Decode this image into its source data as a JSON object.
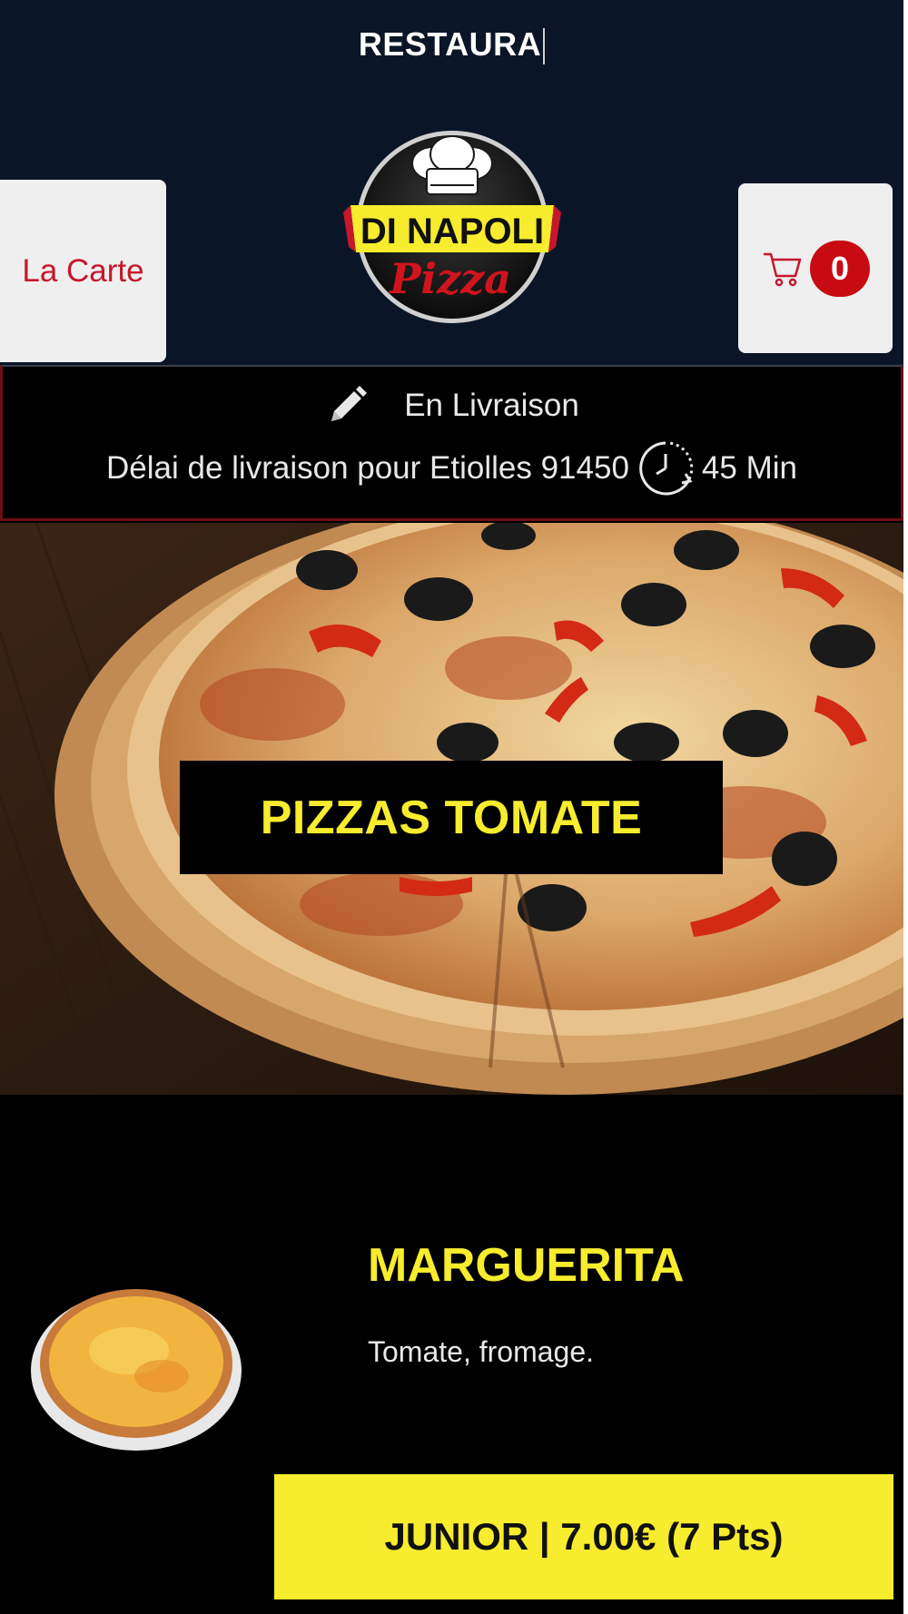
{
  "header": {
    "title": "RESTAURA",
    "menu_button_label": "La Carte",
    "cart_count": "0",
    "logo": {
      "top_text": "DI NAPOLI",
      "script_text": "Pizza"
    }
  },
  "delivery": {
    "mode": "En Livraison",
    "delay_text": "Délai de livraison pour Etiolles 91450",
    "delay_value": "45 Min"
  },
  "category": {
    "title": "PIZZAS TOMATE"
  },
  "product": {
    "name": "MARGUERITA",
    "description": "Tomate, fromage.",
    "option_label": "JUNIOR | 7.00€ (7 Pts)"
  },
  "colors": {
    "header_bg": "#0a1628",
    "accent_red": "#c6172c",
    "accent_yellow": "#f7ec2d",
    "page_bg": "#000000"
  },
  "icons": [
    "cart-icon",
    "pencil-icon",
    "clock-icon"
  ]
}
